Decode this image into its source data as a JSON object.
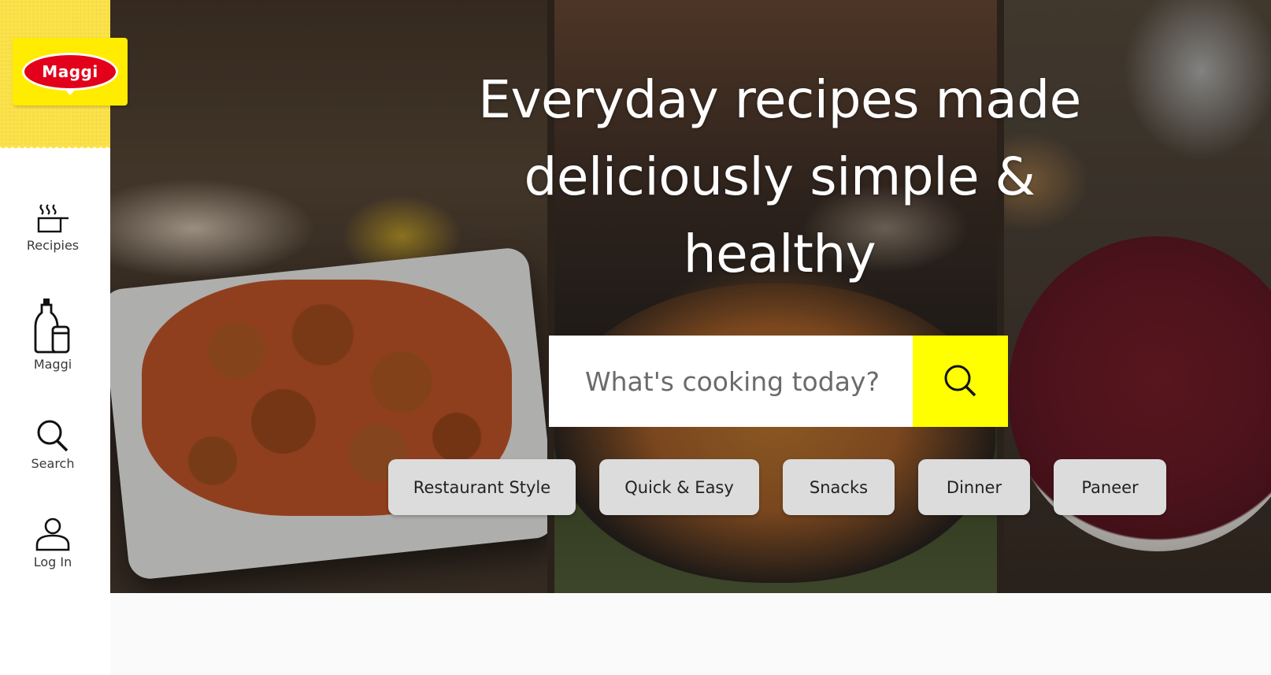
{
  "brand": {
    "logo_text": "Maggi",
    "logo_red": "#e2001a",
    "logo_yellow": "#ffec00"
  },
  "sidebar": {
    "items": [
      {
        "label": "Recipies",
        "icon": "cooking-pot-icon"
      },
      {
        "label": "Maggi",
        "icon": "bottle-jar-icon"
      },
      {
        "label": "Search",
        "icon": "search-icon"
      },
      {
        "label": "Log In",
        "icon": "user-icon"
      }
    ]
  },
  "hero": {
    "headline": "Everyday recipes made deliciously simple & healthy",
    "search": {
      "placeholder": "What's cooking today?",
      "value": ""
    },
    "search_button_color": "#ffff00",
    "categories": [
      {
        "label": "Restaurant Style"
      },
      {
        "label": "Quick & Easy"
      },
      {
        "label": "Snacks"
      },
      {
        "label": "Dinner"
      },
      {
        "label": "Paneer"
      }
    ]
  }
}
